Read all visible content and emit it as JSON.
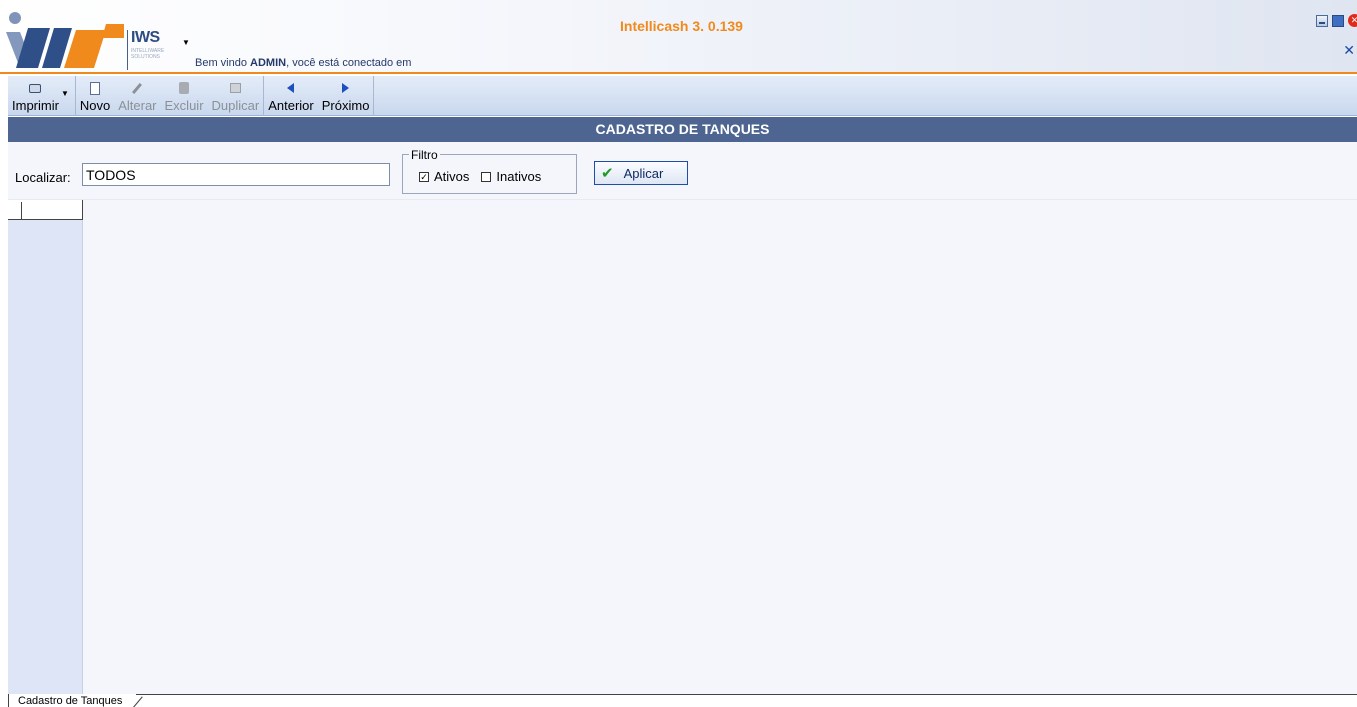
{
  "header": {
    "logo_text": "IWS",
    "logo_subtext": "INTELLIWARE SOLUTIONS",
    "welcome_prefix": "Bem vindo ",
    "welcome_user": "ADMIN",
    "welcome_suffix": ", você está conectado em",
    "app_title": "Intellicash 3. 0.139"
  },
  "toolbar": {
    "print": "Imprimir",
    "new": "Novo",
    "edit": "Alterar",
    "delete": "Excluir",
    "duplicate": "Duplicar",
    "previous": "Anterior",
    "next": "Próximo"
  },
  "page": {
    "title": "CADASTRO DE TANQUES"
  },
  "filter": {
    "search_label": "Localizar:",
    "search_value": "TODOS",
    "group_label": "Filtro",
    "active_label": "Ativos",
    "active_checked": true,
    "inactive_label": "Inativos",
    "inactive_checked": false,
    "apply_label": "Aplicar"
  },
  "tabs": [
    {
      "label": "Cadastro de Tanques"
    }
  ],
  "colors": {
    "accent_orange": "#f08a1c",
    "title_bar": "#4d6590",
    "toolbar_bg": "#c9d8ee"
  }
}
